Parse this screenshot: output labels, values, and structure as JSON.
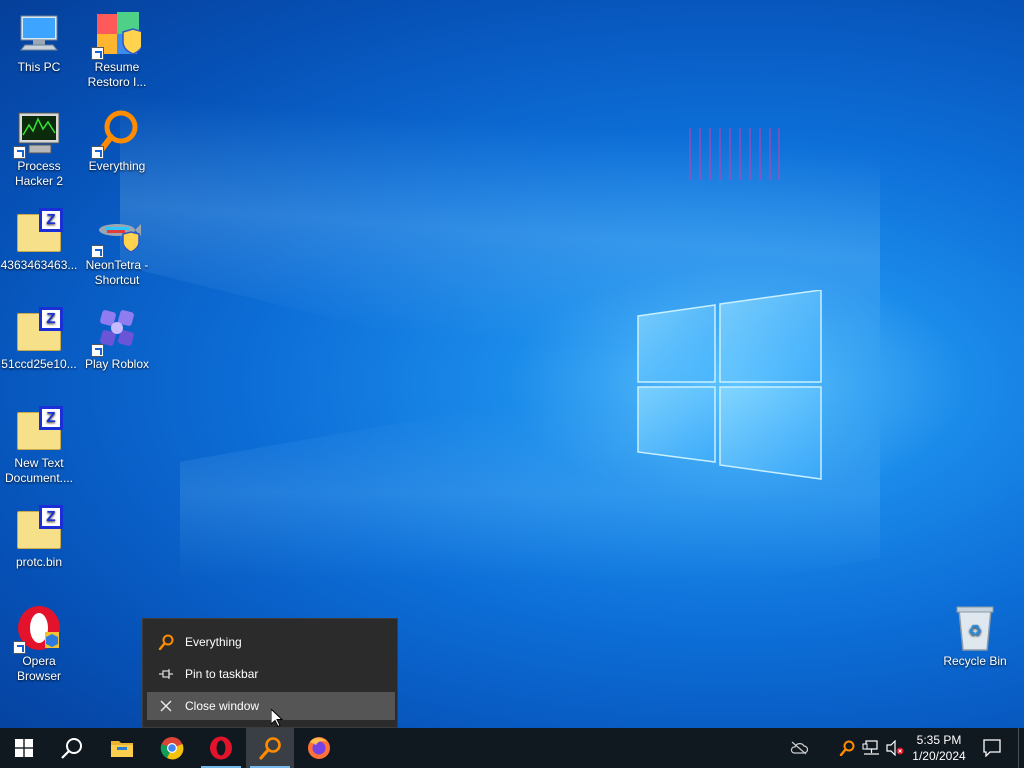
{
  "desktop": {
    "icons": [
      {
        "label": "This PC"
      },
      {
        "label": "Resume Restoro I..."
      },
      {
        "label": "Process Hacker 2"
      },
      {
        "label": "Everything"
      },
      {
        "label": "4363463463..."
      },
      {
        "label": "NeonTetra - Shortcut"
      },
      {
        "label": "51ccd25e10..."
      },
      {
        "label": "Play Roblox"
      },
      {
        "label": "New Text Document...."
      },
      {
        "label": "protc.bin"
      },
      {
        "label": "Opera Browser"
      },
      {
        "label": "Recycle Bin"
      }
    ]
  },
  "jumplist": {
    "app_label": "Everything",
    "pin_label": "Pin to taskbar",
    "close_label": "Close window"
  },
  "taskbar": {
    "apps": [
      "start-icon",
      "search-icon",
      "file-explorer-icon",
      "chrome-icon",
      "opera-icon",
      "everything-icon",
      "firefox-icon"
    ],
    "clock": {
      "time": "5:35 PM",
      "date": "1/20/2024"
    }
  },
  "colors": {
    "accent": "#76b9ed",
    "taskbar_bg": "#101820",
    "menu_bg": "#2b2b2b",
    "everything_orange": "#ff8c00"
  }
}
